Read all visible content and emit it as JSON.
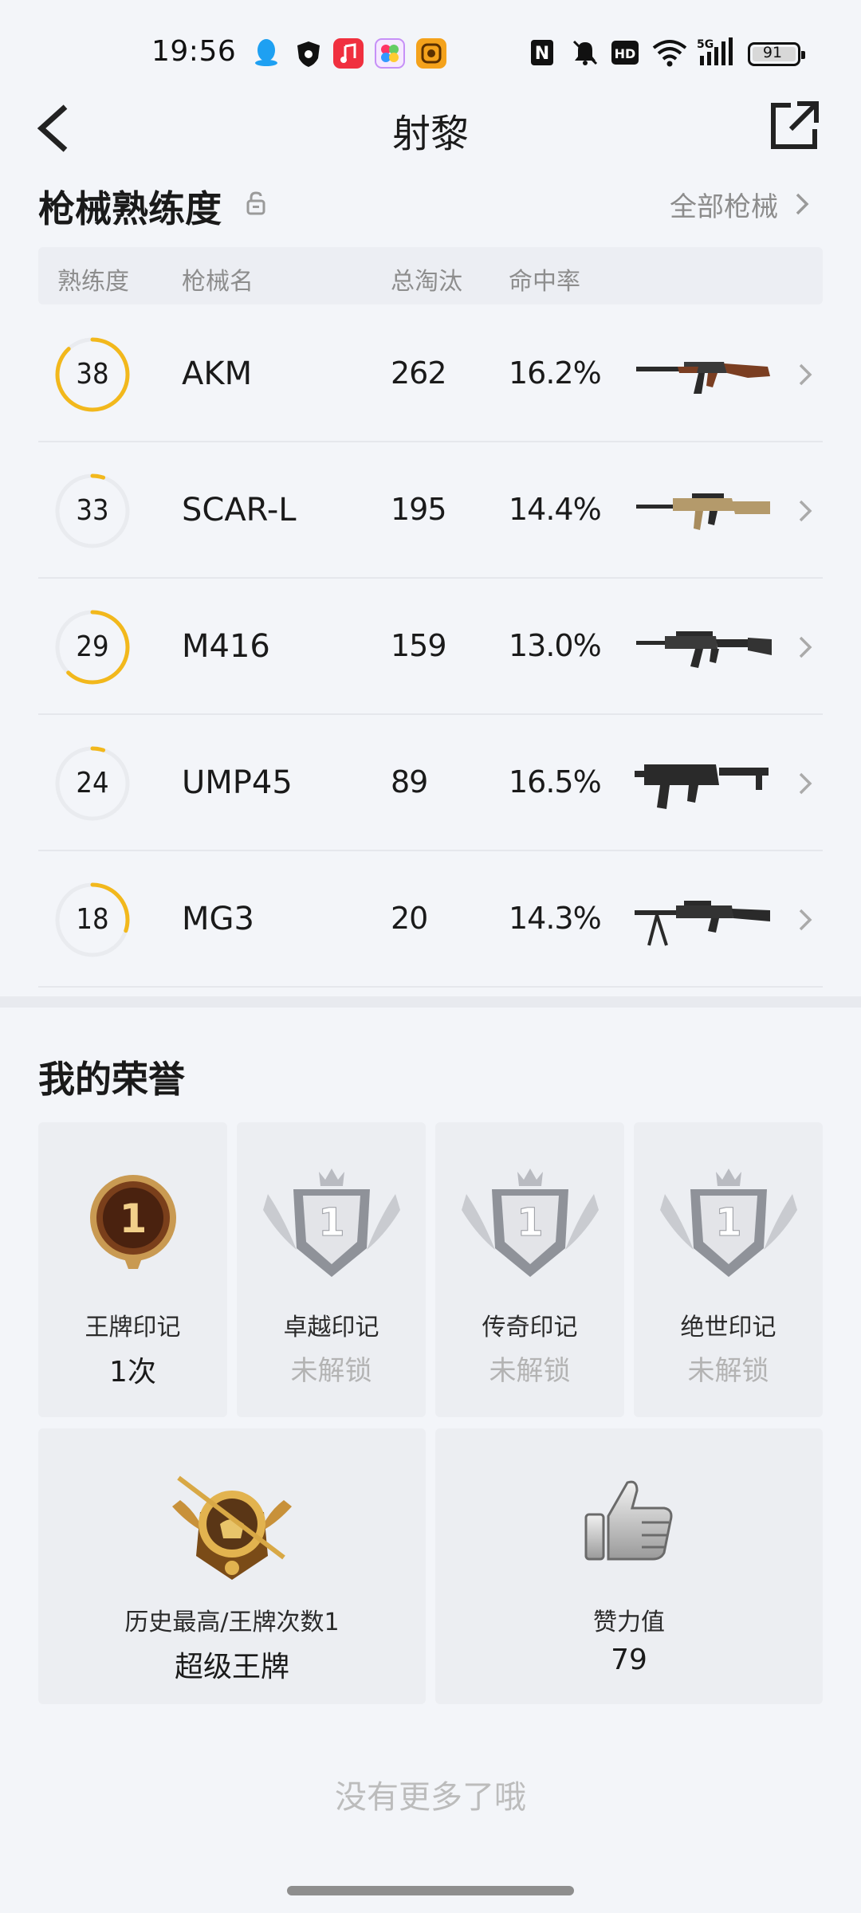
{
  "status_bar": {
    "time": "19:56",
    "battery": "91",
    "network": "5G",
    "hd_label": "HD",
    "nfc_label": "N"
  },
  "header": {
    "title": "射黎"
  },
  "weapons_section": {
    "title": "枪械熟练度",
    "all_link": "全部枪械",
    "columns": {
      "mastery": "熟练度",
      "name": "枪械名",
      "eliminations": "总淘汰",
      "accuracy": "命中率"
    },
    "rows": [
      {
        "level": "38",
        "progress": 0.88,
        "name": "AKM",
        "eliminations": "262",
        "accuracy": "16.2%",
        "icon": "akm-rifle-icon"
      },
      {
        "level": "33",
        "progress": 0.05,
        "name": "SCAR-L",
        "eliminations": "195",
        "accuracy": "14.4%",
        "icon": "scar-l-rifle-icon"
      },
      {
        "level": "29",
        "progress": 0.62,
        "name": "M416",
        "eliminations": "159",
        "accuracy": "13.0%",
        "icon": "m416-rifle-icon"
      },
      {
        "level": "24",
        "progress": 0.05,
        "name": "UMP45",
        "eliminations": "89",
        "accuracy": "16.5%",
        "icon": "ump45-smg-icon"
      },
      {
        "level": "18",
        "progress": 0.3,
        "name": "MG3",
        "eliminations": "20",
        "accuracy": "14.3%",
        "icon": "mg3-lmg-icon"
      }
    ],
    "colors": {
      "ring_progress": "#f2b81c",
      "ring_track": "#e9ebef"
    }
  },
  "honor_section": {
    "title": "我的荣誉",
    "marks": [
      {
        "label": "王牌印记",
        "value": "1次",
        "locked": false,
        "emblem_number": "1",
        "icon": "ace-mark-icon"
      },
      {
        "label": "卓越印记",
        "value": "未解锁",
        "locked": true,
        "emblem_number": "1",
        "icon": "excellence-mark-icon"
      },
      {
        "label": "传奇印记",
        "value": "未解锁",
        "locked": true,
        "emblem_number": "1",
        "icon": "legend-mark-icon"
      },
      {
        "label": "绝世印记",
        "value": "未解锁",
        "locked": true,
        "emblem_number": "1",
        "icon": "peerless-mark-icon"
      }
    ],
    "rank": {
      "label": "历史最高/王牌次数1",
      "value": "超级王牌",
      "icon": "super-ace-rank-icon"
    },
    "likes": {
      "label": "赞力值",
      "value": "79",
      "icon": "thumbs-up-icon"
    }
  },
  "footer": {
    "no_more": "没有更多了哦"
  }
}
